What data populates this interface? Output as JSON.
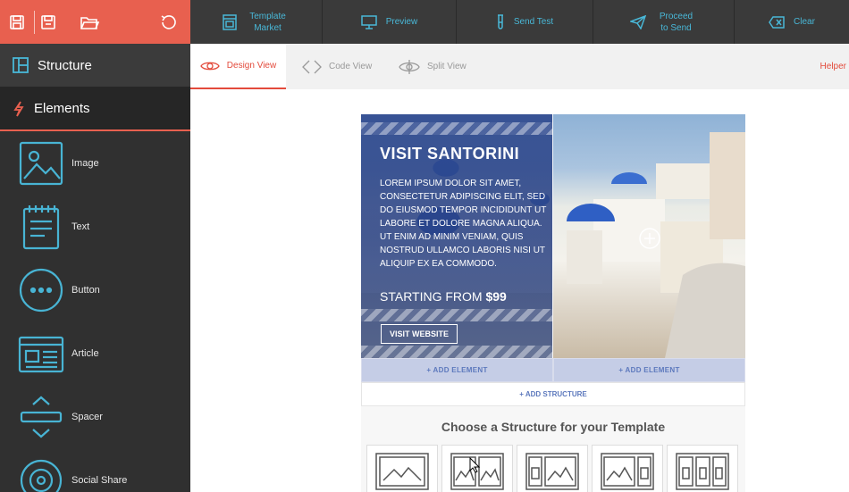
{
  "toolbar": {
    "template_market": "Template Market",
    "preview": "Preview",
    "send_test": "Send Test",
    "proceed_to_send": "Proceed to Send",
    "clear": "Clear"
  },
  "sidebar": {
    "structure_label": "Structure",
    "elements_label": "Elements",
    "items": [
      {
        "label": "Image",
        "icon": "image-icon"
      },
      {
        "label": "Text",
        "icon": "text-icon"
      },
      {
        "label": "Button",
        "icon": "button-icon"
      },
      {
        "label": "Article",
        "icon": "article-icon"
      },
      {
        "label": "Spacer",
        "icon": "spacer-icon"
      },
      {
        "label": "Social Share",
        "icon": "social-icon"
      }
    ]
  },
  "views": {
    "design": "Design View",
    "code": "Code View",
    "split": "Split View",
    "helper": "Helper"
  },
  "template": {
    "title": "VISIT SANTORINI",
    "body": "Lorem ipsum dolor sit amet, consectetur adipiscing elit, sed do eiusmod tempor incididunt ut labore et dolore magna aliqua. Ut enim ad minim veniam, quis nostrud ullamco laboris nisi ut aliquip ex ea commodo.",
    "price_prefix": "STARTING FROM ",
    "price": "$99",
    "button": "VISIT WEBSITE"
  },
  "canvas": {
    "add_element": "+ ADD ELEMENT",
    "add_structure": "+ ADD STRUCTURE",
    "choose_title": "Choose a Structure for your Template"
  },
  "colors": {
    "accent": "#e8604f",
    "sidebar_bg": "#303030",
    "toolbar_icon": "#49b8d8",
    "active_tab": "#e34a3b"
  }
}
